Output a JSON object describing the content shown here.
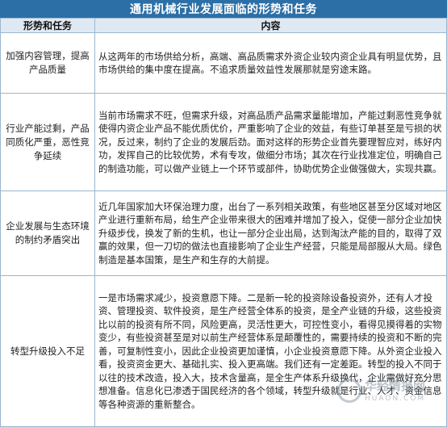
{
  "title": "通用机械行业发展面临的形势和任务",
  "headers": {
    "topic": "形势和任务",
    "content": "内容"
  },
  "rows": [
    {
      "topic": "加强内容管理，提高产品质量",
      "content": "从这两年的市场供给分析，高端、高品质需求外资企业较内资企业具有明显优势，且市场供给的集中度在提高。不追求质量效益性发展那就是穷途末路。"
    },
    {
      "topic": "行业产能过剩，产品同质化严重，恶性竞争延续",
      "content": "当前市场需求不旺，但需求升级，对高品质产品需求量能增加，产能过剩恶性竞争就使得内资企业产品不能优质优价，严重影响了企业的效益，有些订单甚至是亏损的状况，反过来，制约了企业的发展后劲。面对这样的形势企业首先要理智应对，练好内功，发挥自己的比较优势，术有专攻，做细分市场；其次在行业找准定位，明确自己的制造功能，可以做产业链上一个环节或部件，协助优势企业做强做大，实现共赢。"
    },
    {
      "topic": "企业发展与生态环境的制约矛盾突出",
      "content": "近几年国家加大环保治理力度，出台了一系列相关政策，有些地区甚至分区域对地区产业进行重新布局，给生产企业带来很大的困难并增加了投入，促使一部分企业加快升级步伐，换发了新的生机，也让一部分企业出局，达到淘汰产能的目的，取得了双赢的效果，但一刀切的做法也直接影响了企业生产经营，只能是局部服从大局。绿色制造是基本国策，是生产和生存的大前提。"
    },
    {
      "topic": "转型升级投入不足",
      "content": "一是市场需求减少，投资意愿下降。二是新一轮的投资除设备投资外，还有人才投资、管理投资、软件投资，是生产经营全体系的投资，是全产业链的升级，这些投资比以前的投资有所不同，风险更高，灵活性更大，可控性变小，看得见摸得着的实物变少，有些投资甚至是对以前生产经营体系是颠覆性的，需要持续的投资和不断的完善，可复制性变小，因此企业投资更加谨慎，小企业投资意愿下降。从外资企业投入看，投资资金更大、基础扎实、投入更高端。我们还有一定差距。转型的投入不同于以往的技术改造，投入大，技术含量高，是全生产体系升级换代，企业需做好充分思想准备。信息化已渗透于国民经济的各个领域，转型升级就是行业、人才、资金信息等各种资源的重新整合。"
    }
  ],
  "watermark": {
    "text": "华经情报网",
    "sub": "HUAON.COM"
  }
}
